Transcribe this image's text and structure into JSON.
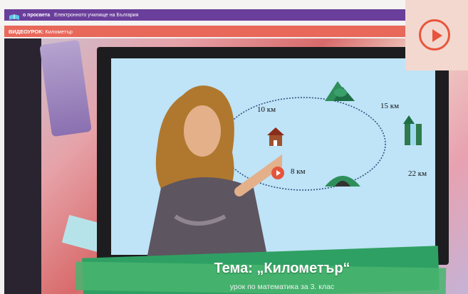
{
  "header": {
    "logo_name": "о просвета",
    "tagline": "Електронното училище на България"
  },
  "subheader": {
    "label": "ВИДЕОУРОК:",
    "title": "Километър"
  },
  "video": {
    "diagram_labels": {
      "d1": "10 км",
      "d2": "15 км",
      "d3": "8 км",
      "d4": "22 км"
    },
    "topic": "Тема: „Километър“",
    "lesson_subtitle": "урок по математика за 3. клас"
  },
  "colors": {
    "brand_purple": "#6a3e9b",
    "subheader_coral": "#e8685a",
    "play_accent": "#e8553c",
    "banner_green": "#2fa063"
  },
  "icons": {
    "play_button": "play-icon",
    "logo": "book-logo-icon"
  }
}
